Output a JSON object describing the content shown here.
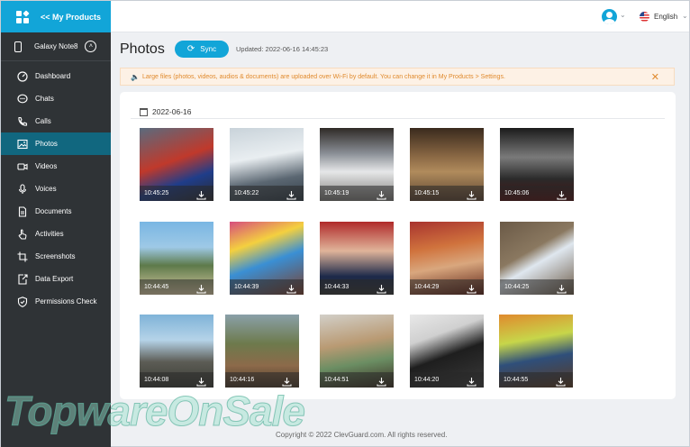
{
  "sidebar": {
    "brand": "<< My Products",
    "device": "Galaxy Note8",
    "items": [
      {
        "label": "Dashboard",
        "icon": "dashboard-icon"
      },
      {
        "label": "Chats",
        "icon": "chat-bubble-icon"
      },
      {
        "label": "Calls",
        "icon": "phone-icon"
      },
      {
        "label": "Photos",
        "icon": "image-icon"
      },
      {
        "label": "Videos",
        "icon": "video-camera-icon"
      },
      {
        "label": "Voices",
        "icon": "microphone-icon"
      },
      {
        "label": "Documents",
        "icon": "document-icon"
      },
      {
        "label": "Activities",
        "icon": "hand-pointer-icon"
      },
      {
        "label": "Screenshots",
        "icon": "crop-icon"
      },
      {
        "label": "Data Export",
        "icon": "export-icon"
      },
      {
        "label": "Permissions Check",
        "icon": "shield-check-icon"
      }
    ],
    "active": "Photos"
  },
  "topbar": {
    "language": "English"
  },
  "header": {
    "title": "Photos",
    "sync_label": "Sync",
    "updated": "Updated: 2022-06-16 14:45:23"
  },
  "notice": {
    "text": "Large files (photos, videos, audios & documents) are uploaded over Wi-Fi by default. You can change it in My Products > Settings."
  },
  "gallery": {
    "date": "2022-06-16",
    "photos": [
      {
        "time": "10:45:25",
        "desc": "cyclist sprint"
      },
      {
        "time": "10:45:22",
        "desc": "waves on rocks"
      },
      {
        "time": "10:45:19",
        "desc": "modern interior"
      },
      {
        "time": "10:45:15",
        "desc": "wooden hall"
      },
      {
        "time": "10:45:06",
        "desc": "red carpet"
      },
      {
        "time": "10:44:45",
        "desc": "tropical beach"
      },
      {
        "time": "10:44:39",
        "desc": "festival flags"
      },
      {
        "time": "10:44:33",
        "desc": "speaker at podium"
      },
      {
        "time": "10:44:29",
        "desc": "woman with city"
      },
      {
        "time": "10:44:25",
        "desc": "phone on table"
      },
      {
        "time": "10:44:08",
        "desc": "harbour terrace"
      },
      {
        "time": "10:44:16",
        "desc": "hillside village"
      },
      {
        "time": "10:44:51",
        "desc": "wallet with cash"
      },
      {
        "time": "10:44:20",
        "desc": "black phone"
      },
      {
        "time": "10:44:55",
        "desc": "street seller"
      }
    ]
  },
  "footer": "Copyright © 2022 ClevGuard.com. All rights reserved.",
  "watermark": "TopwareOnSale",
  "colors": {
    "accent": "#12a5d8",
    "sidebar": "#2f3336",
    "active": "#11677f",
    "notice": "#e08a2d"
  }
}
